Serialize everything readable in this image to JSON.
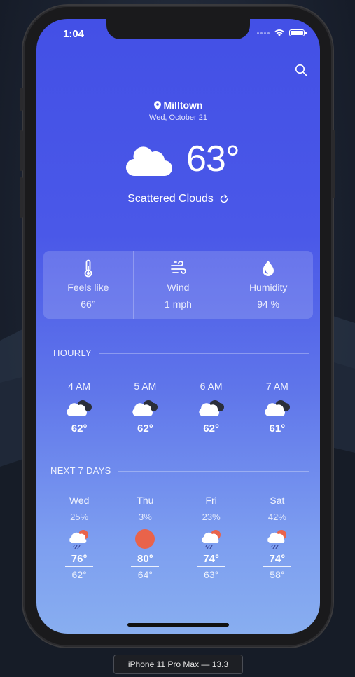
{
  "status_bar": {
    "time": "1:04"
  },
  "header": {
    "location": "Milltown",
    "date": "Wed, October 21"
  },
  "current": {
    "temperature": "63°",
    "condition": "Scattered Clouds",
    "icon": "cloud-icon"
  },
  "stats": [
    {
      "label": "Feels like",
      "value": "66°",
      "icon": "thermometer-icon"
    },
    {
      "label": "Wind",
      "value": "1 mph",
      "icon": "wind-icon"
    },
    {
      "label": "Humidity",
      "value": "94 %",
      "icon": "droplet-icon"
    }
  ],
  "hourly": {
    "title": "HOURLY",
    "items": [
      {
        "time": "4 AM",
        "temp": "62°",
        "icon": "partly-cloudy-night-icon"
      },
      {
        "time": "5 AM",
        "temp": "62°",
        "icon": "partly-cloudy-night-icon"
      },
      {
        "time": "6 AM",
        "temp": "62°",
        "icon": "partly-cloudy-night-icon"
      },
      {
        "time": "7 AM",
        "temp": "61°",
        "icon": "partly-cloudy-night-icon"
      }
    ]
  },
  "daily": {
    "title": "NEXT 7 DAYS",
    "items": [
      {
        "day": "Wed",
        "precip": "25%",
        "high": "76°",
        "low": "62°",
        "icon": "rain-sun-icon"
      },
      {
        "day": "Thu",
        "precip": "3%",
        "high": "80°",
        "low": "64°",
        "icon": "sun-icon"
      },
      {
        "day": "Fri",
        "precip": "23%",
        "high": "74°",
        "low": "63°",
        "icon": "rain-sun-icon"
      },
      {
        "day": "Sat",
        "precip": "42%",
        "high": "74°",
        "low": "58°",
        "icon": "rain-sun-icon"
      }
    ]
  },
  "device_label": "iPhone 11 Pro Max — 13.3",
  "colors": {
    "gradient_top": "#4350e6",
    "gradient_bottom": "#88aef0",
    "sun": "#e9634a"
  }
}
